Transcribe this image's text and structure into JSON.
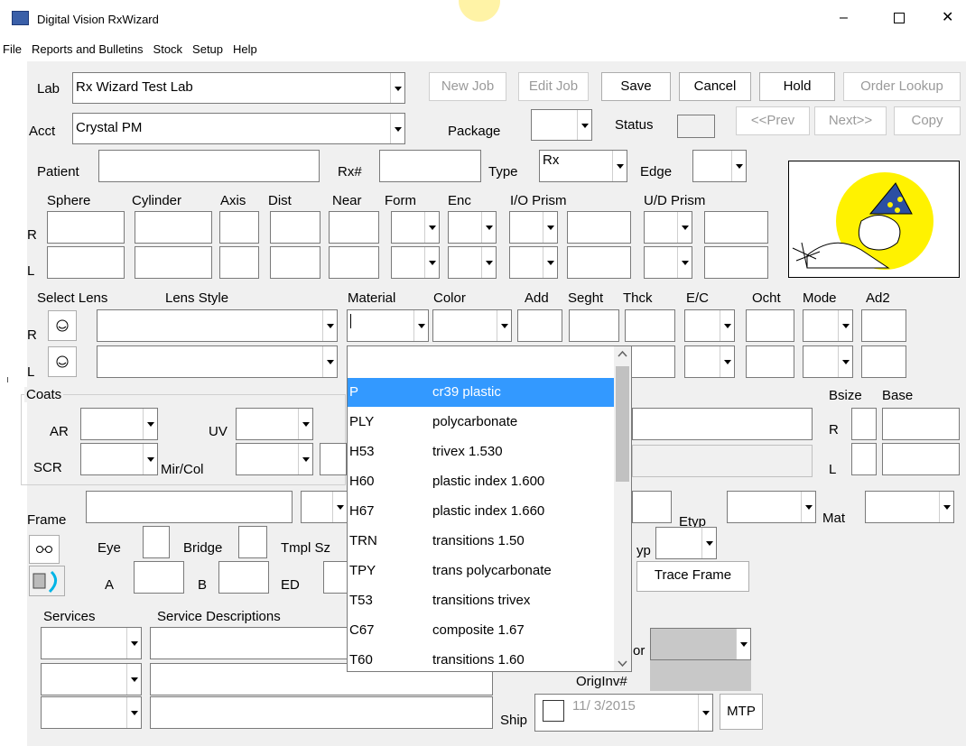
{
  "window": {
    "title": "Digital Vision RxWizard",
    "minimize": "–",
    "maximize": "☐",
    "close": "✕"
  },
  "menu": [
    "File",
    "Reports and Bulletins",
    "Stock",
    "Setup",
    "Help"
  ],
  "labels": {
    "lab": "Lab",
    "acct": "Acct",
    "package": "Package",
    "status": "Status",
    "patient": "Patient",
    "rx": "Rx#",
    "type": "Type",
    "edge": "Edge",
    "sphere": "Sphere",
    "cylinder": "Cylinder",
    "axis": "Axis",
    "dist": "Dist",
    "near": "Near",
    "form": "Form",
    "enc": "Enc",
    "io_prism": "I/O Prism",
    "ud_prism": "U/D Prism",
    "r": "R",
    "l": "L",
    "select_lens": "Select Lens",
    "lens_style": "Lens Style",
    "material": "Material",
    "color": "Color",
    "add": "Add",
    "seght": "Seght",
    "thck": "Thck",
    "ec": "E/C",
    "ocht": "Ocht",
    "mode": "Mode",
    "ad2": "Ad2",
    "coats": "Coats",
    "ar": "AR",
    "uv": "UV",
    "scr": "SCR",
    "mircol": "Mir/Col",
    "bsize": "Bsize",
    "base": "Base",
    "frame": "Frame",
    "etyp": "Etyp",
    "mat": "Mat",
    "eye": "Eye",
    "bridge": "Bridge",
    "tmplsz": "Tmpl Sz",
    "a": "A",
    "b": "B",
    "ed": "ED",
    "yp": "yp",
    "services": "Services",
    "service_desc": "Service Descriptions",
    "or": "or",
    "originv": "OrigInv#",
    "ship": "Ship"
  },
  "values": {
    "lab": "Rx Wizard Test Lab",
    "acct": "Crystal PM",
    "type": "Rx",
    "ship_date": "11/ 3/2015"
  },
  "buttons": {
    "new_job": "New Job",
    "edit_job": "Edit Job",
    "save": "Save",
    "cancel": "Cancel",
    "hold": "Hold",
    "order_lookup": "Order Lookup",
    "prev": "<<Prev",
    "next": "Next>>",
    "copy": "Copy",
    "trace_frame": "Trace Frame",
    "mtp": "MTP"
  },
  "material_dropdown": [
    {
      "code": "P",
      "desc": "cr39 plastic"
    },
    {
      "code": "PLY",
      "desc": "polycarbonate"
    },
    {
      "code": "H53",
      "desc": "trivex 1.530"
    },
    {
      "code": "H60",
      "desc": "plastic index 1.600"
    },
    {
      "code": "H67",
      "desc": "plastic index 1.660"
    },
    {
      "code": "TRN",
      "desc": "transitions 1.50"
    },
    {
      "code": "TPY",
      "desc": "trans polycarbonate"
    },
    {
      "code": "T53",
      "desc": "transitions trivex"
    },
    {
      "code": "C67",
      "desc": "composite 1.67"
    },
    {
      "code": "T60",
      "desc": "transitions 1.60"
    }
  ],
  "colors": {
    "selection": "#3399ff",
    "form_bg": "#f0f0f0",
    "field_disabled": "#c8c8c8",
    "logo_glow": "#fff200"
  }
}
